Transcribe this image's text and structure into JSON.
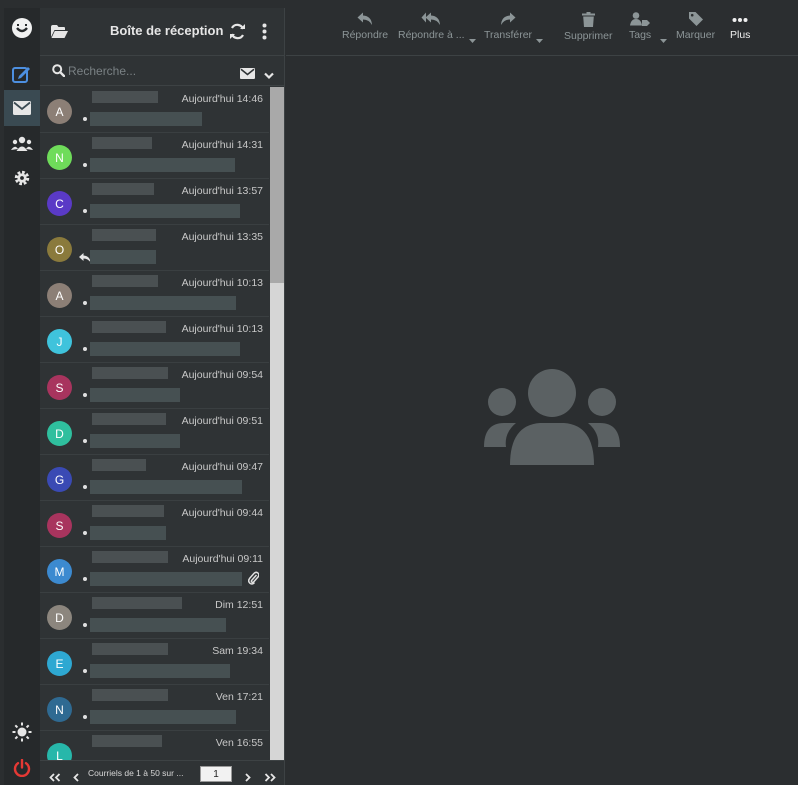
{
  "toolbar": {
    "reply": "Répondre",
    "reply_all": "Répondre à ...",
    "forward": "Transférer",
    "delete": "Supprimer",
    "tags": "Tags",
    "mark": "Marquer",
    "more": "Plus"
  },
  "list": {
    "title": "Boîte de réception",
    "search_placeholder": "Recherche..."
  },
  "messages": [
    {
      "initial": "A",
      "color": "#8c7f76",
      "date": "Aujourd'hui 14:46"
    },
    {
      "initial": "N",
      "color": "#6fdc5a",
      "date": "Aujourd'hui 14:31"
    },
    {
      "initial": "C",
      "color": "#5a3ac6",
      "date": "Aujourd'hui 13:57"
    },
    {
      "initial": "O",
      "color": "#8a7a3c",
      "date": "Aujourd'hui 13:35"
    },
    {
      "initial": "A",
      "color": "#8c7f76",
      "date": "Aujourd'hui 10:13"
    },
    {
      "initial": "J",
      "color": "#3fc3dc",
      "date": "Aujourd'hui 10:13"
    },
    {
      "initial": "S",
      "color": "#a8345e",
      "date": "Aujourd'hui 09:54"
    },
    {
      "initial": "D",
      "color": "#2fbf9e",
      "date": "Aujourd'hui 09:51"
    },
    {
      "initial": "G",
      "color": "#3a4ab4",
      "date": "Aujourd'hui 09:47"
    },
    {
      "initial": "S",
      "color": "#a8345e",
      "date": "Aujourd'hui 09:44"
    },
    {
      "initial": "M",
      "color": "#3c8ad0",
      "date": "Aujourd'hui 09:11"
    },
    {
      "initial": "D",
      "color": "#8c867e",
      "date": "Dim 12:51"
    },
    {
      "initial": "E",
      "color": "#2ea8d2",
      "date": "Sam 19:34"
    },
    {
      "initial": "N",
      "color": "#2f6a92",
      "date": "Ven 17:21"
    },
    {
      "initial": "L",
      "color": "#27b7aa",
      "date": "Ven 16:55"
    }
  ],
  "pager": {
    "text": "Courriels de 1 à 50 sur ...",
    "page": "1"
  },
  "colors": {
    "accent": "#4d8fe0",
    "logout": "#e53935"
  }
}
